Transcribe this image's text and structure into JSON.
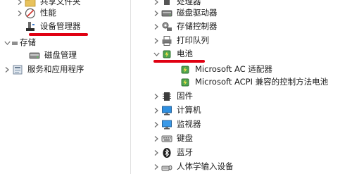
{
  "left_tree": {
    "items": [
      {
        "label": "共享文件夹",
        "icon": "shared-folder-icon",
        "expanded": false
      },
      {
        "label": "性能",
        "icon": "performance-icon",
        "expanded": false
      },
      {
        "label": "设备管理器",
        "icon": "device-manager-icon",
        "selected": true
      },
      {
        "label": "存储",
        "icon": "storage-icon",
        "expanded": true
      },
      {
        "label": "磁盘管理",
        "icon": "disk-management-icon"
      },
      {
        "label": "服务和应用程序",
        "icon": "services-apps-icon",
        "expanded": false
      }
    ]
  },
  "right_tree": {
    "items": [
      {
        "label": "处理器",
        "icon": "processor-icon",
        "expanded": false
      },
      {
        "label": "磁盘驱动器",
        "icon": "disk-drive-icon",
        "expanded": false
      },
      {
        "label": "存储控制器",
        "icon": "storage-controller-icon",
        "expanded": false
      },
      {
        "label": "打印队列",
        "icon": "print-queue-icon",
        "expanded": false
      },
      {
        "label": "电池",
        "icon": "battery-icon",
        "expanded": true
      },
      {
        "label": "Microsoft AC 适配器",
        "icon": "battery-device-icon",
        "child": true
      },
      {
        "label": "Microsoft ACPI 兼容的控制方法电池",
        "icon": "battery-device-icon",
        "child": true
      },
      {
        "label": "固件",
        "icon": "firmware-icon",
        "expanded": false
      },
      {
        "label": "计算机",
        "icon": "computer-icon",
        "expanded": false
      },
      {
        "label": "监视器",
        "icon": "monitor-icon",
        "expanded": false
      },
      {
        "label": "键盘",
        "icon": "keyboard-icon",
        "expanded": false
      },
      {
        "label": "蓝牙",
        "icon": "bluetooth-icon",
        "expanded": false
      },
      {
        "label": "人体学输入设备",
        "icon": "hid-icon",
        "expanded": false
      }
    ]
  },
  "colors": {
    "annotation": "#e00012",
    "chevron": "#6b6b6b"
  }
}
